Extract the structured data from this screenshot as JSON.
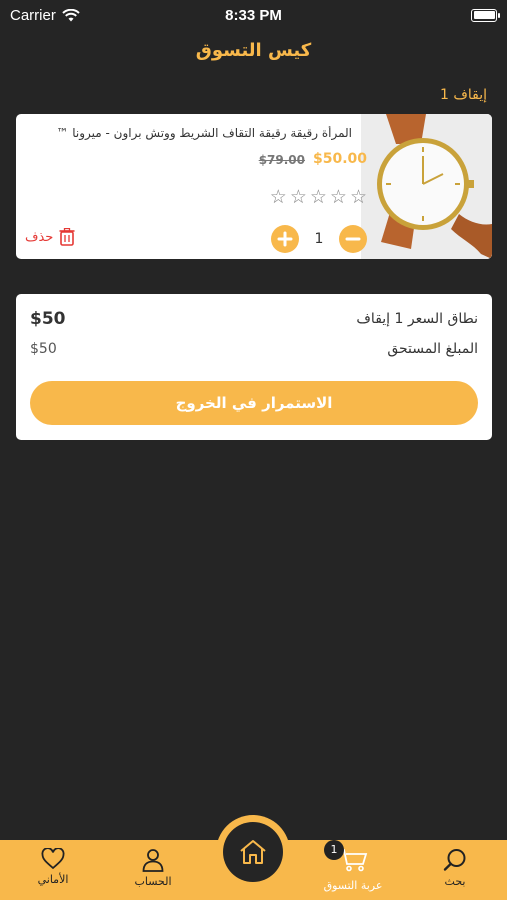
{
  "status_bar": {
    "carrier": "Carrier",
    "time": "8:33 PM"
  },
  "header": {
    "title": "كيس التسوق"
  },
  "cart": {
    "items_count": "1 إيقاف",
    "items": [
      {
        "name": "المرأة رقيقة رقيقة التقاف الشريط ووتش براون - ميرونا ™",
        "price": "$50.00",
        "old_price": "$79.00",
        "rating": 0,
        "rating_max": 5,
        "quantity": "1",
        "delete_label": "حذف"
      }
    ]
  },
  "summary": {
    "price_range_label": "نطاق السعر   1 إيقاف",
    "price_range_value": "$50",
    "amount_due_label": "المبلغ المستحق",
    "amount_due_value": "$50",
    "checkout_label": "الاستمرار في الخروج"
  },
  "tab_bar": {
    "tabs": [
      {
        "label": "الأماني",
        "icon": "heart-icon"
      },
      {
        "label": "الحساب",
        "icon": "user-icon"
      },
      {
        "label": "",
        "icon": "home-icon"
      },
      {
        "label": "عربة التسوق",
        "icon": "cart-icon",
        "badge": "1",
        "active": true
      },
      {
        "label": "بحث",
        "icon": "search-icon"
      }
    ]
  },
  "colors": {
    "accent": "#f8b84b",
    "background": "#252525",
    "delete": "#e53935"
  }
}
